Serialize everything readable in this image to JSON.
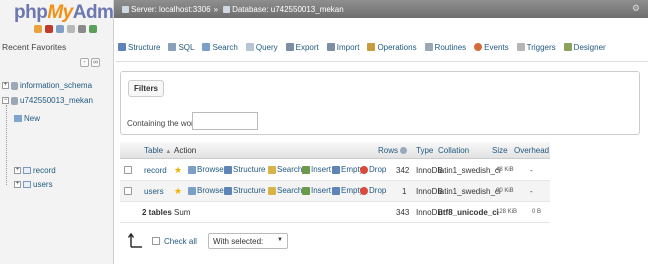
{
  "app": {
    "logo_php": "php",
    "logo_my": "My",
    "logo_admin": "Admin",
    "recent_favorites": "Recent Favorites"
  },
  "navigation": {
    "databases": [
      {
        "name": "information_schema"
      },
      {
        "name": "u742550013_mekan"
      }
    ],
    "new_label": "New",
    "tables": [
      "record",
      "users"
    ]
  },
  "breadcrumb": {
    "server_label": "Server: localhost:3306",
    "separator": "»",
    "database_label": "Database: u742550013_mekan"
  },
  "tabs": [
    {
      "label": "Structure",
      "icon": "structure-icon",
      "color": "#5f84b8"
    },
    {
      "label": "SQL",
      "icon": "sql-icon",
      "color": "#8a9fb8"
    },
    {
      "label": "Search",
      "icon": "search-icon",
      "color": "#7aa0c8"
    },
    {
      "label": "Query",
      "icon": "query-icon",
      "color": "#b7c4d3"
    },
    {
      "label": "Export",
      "icon": "export-icon",
      "color": "#7c8ea3"
    },
    {
      "label": "Import",
      "icon": "import-icon",
      "color": "#7c8ea3"
    },
    {
      "label": "Operations",
      "icon": "wrench-icon",
      "color": "#c89b3c"
    },
    {
      "label": "Routines",
      "icon": "routines-icon",
      "color": "#9aa7b5"
    },
    {
      "label": "Events",
      "icon": "clock-icon",
      "color": "#d26a3e"
    },
    {
      "label": "Triggers",
      "icon": "triggers-icon",
      "color": "#b5b5b5"
    },
    {
      "label": "Designer",
      "icon": "designer-icon",
      "color": "#8aa35a"
    }
  ],
  "filters": {
    "legend": "Filters",
    "label": "Containing the word:",
    "value": ""
  },
  "table": {
    "headers": {
      "table": "Table",
      "sort_indicator": "▲",
      "action": "Action",
      "rows": "Rows",
      "type": "Type",
      "collation": "Collation",
      "size": "Size",
      "overhead": "Overhead"
    },
    "actions": [
      "Browse",
      "Structure",
      "Search",
      "Insert",
      "Empty",
      "Drop"
    ],
    "rows": [
      {
        "name": "record",
        "rows": "342",
        "type": "InnoDB",
        "collation": "latin1_swedish_ci",
        "size": "48 KiB",
        "overhead": "-"
      },
      {
        "name": "users",
        "rows": "1",
        "type": "InnoDB",
        "collation": "latin1_swedish_ci",
        "size": "80 KiB",
        "overhead": "-"
      }
    ],
    "summary": {
      "tables": "2 tables",
      "sum_label": "Sum",
      "rows": "343",
      "type": "InnoDB",
      "collation": "utf8_unicode_ci",
      "size": "128 KiB",
      "overhead": "0 B"
    }
  },
  "footer": {
    "check_all": "Check all",
    "with_selected": "With selected:"
  },
  "colors": {
    "link": "#235a81",
    "topbar": "#7d7d7d",
    "logo_blue": "#6c78af",
    "logo_orange": "#f29111"
  }
}
